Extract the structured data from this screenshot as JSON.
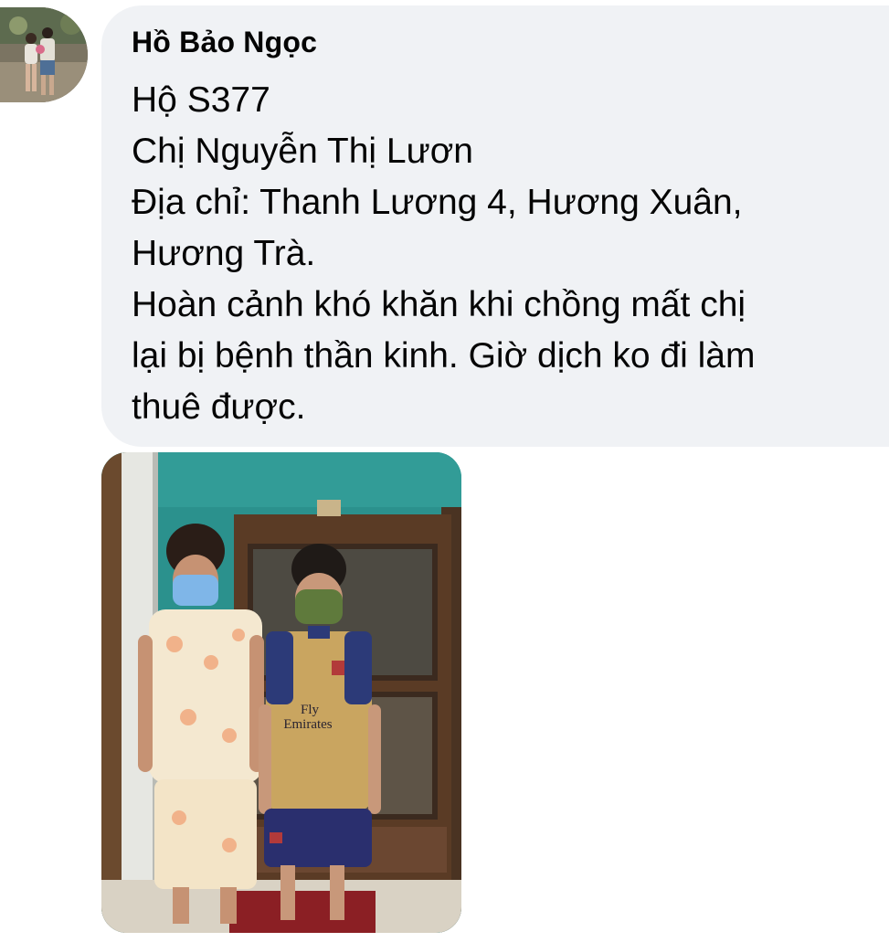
{
  "comment": {
    "author_name": "Hồ Bảo Ngọc",
    "body_lines": [
      "Hộ S377",
      "Chị Nguyễn Thị Lươn",
      "Địa chỉ: Thanh Lương 4, Hương Xuân,",
      "Hương Trà.",
      "Hoàn cảnh khó khăn khi chồng mất chị",
      "lại bị bệnh thần kinh. Giờ dịch ko đi làm",
      "thuê được."
    ],
    "photo_shirt_text_line1": "Fly",
    "photo_shirt_text_line2": "Emirates"
  },
  "colors": {
    "bubble_bg": "#f0f2f5",
    "text": "#050505",
    "wall": "#2a8f8c"
  }
}
